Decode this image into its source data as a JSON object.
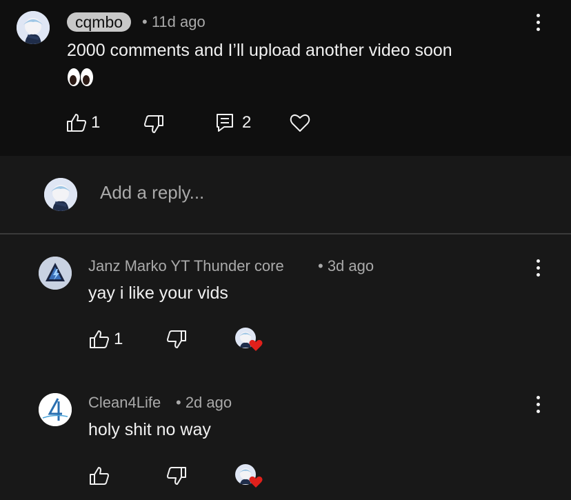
{
  "main_comment": {
    "author": "cqmbo",
    "time": "• 11d ago",
    "text": "2000 comments and I’ll upload another video soon",
    "emoji": "👀",
    "like_count": "1",
    "reply_count": "2"
  },
  "reply_box": {
    "placeholder": "Add a reply..."
  },
  "replies": [
    {
      "author": "Janz Marko YT Thunder core",
      "time": "• 3d ago",
      "text": "yay i like your vids",
      "like_count": "1"
    },
    {
      "author": "Clean4Life",
      "time": "• 2d ago",
      "text": "holy shit no way",
      "like_count": ""
    }
  ],
  "colors": {
    "main_bg": "#0f0f0f",
    "thread_bg": "#181818",
    "text_primary": "#f1f1f1",
    "text_secondary": "#aaaaaa",
    "heart_red": "#e0201b"
  }
}
